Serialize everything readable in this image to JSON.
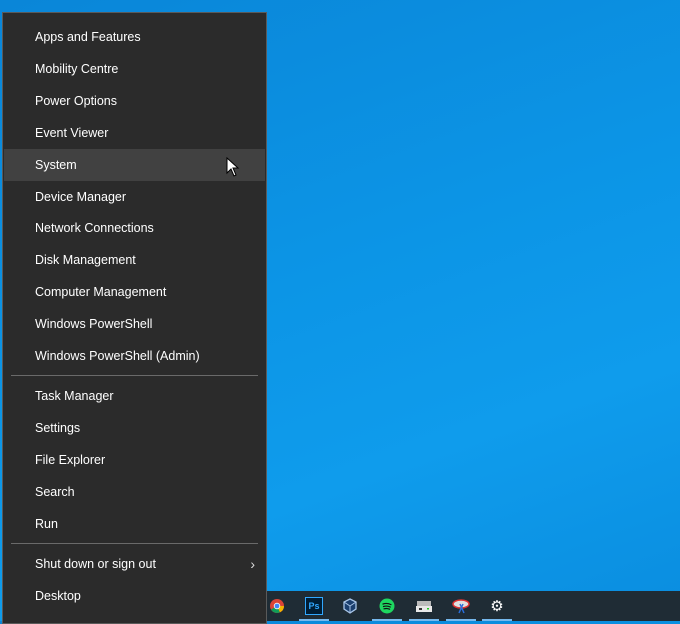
{
  "menu": {
    "group1": [
      "Apps and Features",
      "Mobility Centre",
      "Power Options",
      "Event Viewer",
      "System",
      "Device Manager",
      "Network Connections",
      "Disk Management",
      "Computer Management",
      "Windows PowerShell",
      "Windows PowerShell (Admin)"
    ],
    "group2": [
      "Task Manager",
      "Settings",
      "File Explorer",
      "Search",
      "Run"
    ],
    "group3": [
      "Shut down or sign out",
      "Desktop"
    ],
    "highlighted": "System"
  },
  "taskbar": {
    "icons": [
      "chrome-icon",
      "photoshop-icon",
      "virtualbox-icon",
      "spotify-icon",
      "storage-icon",
      "snipping-icon",
      "settings-icon"
    ],
    "ps_label": "Ps"
  }
}
